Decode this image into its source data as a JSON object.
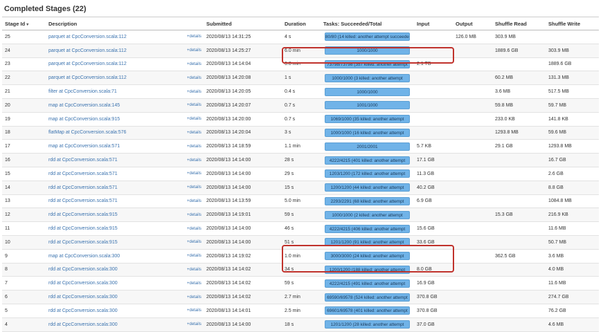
{
  "page": {
    "title": "Completed Stages (22)"
  },
  "columns": [
    {
      "label": "Stage Id",
      "sort": "▾"
    },
    {
      "label": "Description",
      "sort": ""
    },
    {
      "label": "",
      "sort": ""
    },
    {
      "label": "Submitted",
      "sort": ""
    },
    {
      "label": "Duration",
      "sort": ""
    },
    {
      "label": "Tasks: Succeeded/Total",
      "sort": ""
    },
    {
      "label": "Input",
      "sort": ""
    },
    {
      "label": "Output",
      "sort": ""
    },
    {
      "label": "Shuffle Read",
      "sort": ""
    },
    {
      "label": "Shuffle Write",
      "sort": ""
    }
  ],
  "details_label": "+details",
  "rows": [
    {
      "id": "25",
      "desc": "parquet at CpcConversion.scala:112",
      "submitted": "2020/08/13 14:31:25",
      "duration": "4 s",
      "tasks": "80/80 (14 killed: another attempt succeeded)",
      "input": "",
      "output": "126.0 MB",
      "shuffle_read": "303.9 MB",
      "shuffle_write": ""
    },
    {
      "id": "24",
      "desc": "parquet at CpcConversion.scala:112",
      "submitted": "2020/08/13 14:25:27",
      "duration": "6.0 min",
      "tasks": "1000/1000",
      "input": "",
      "output": "",
      "shuffle_read": "1889.6 GB",
      "shuffle_write": "303.9 MB"
    },
    {
      "id": "23",
      "desc": "parquet at CpcConversion.scala:112",
      "submitted": "2020/08/13 14:14:04",
      "duration": "6.8 min",
      "tasks": "73798/73798 (357 killed: another attempt",
      "input": "2.1 TB",
      "output": "",
      "shuffle_read": "",
      "shuffle_write": "1889.6 GB"
    },
    {
      "id": "22",
      "desc": "parquet at CpcConversion.scala:112",
      "submitted": "2020/08/13 14:20:08",
      "duration": "1 s",
      "tasks": "1000/1000 (3 killed: another attempt",
      "input": "",
      "output": "",
      "shuffle_read": "60.2 MB",
      "shuffle_write": "131.3 MB"
    },
    {
      "id": "21",
      "desc": "filter at CpcConversion.scala:71",
      "submitted": "2020/08/13 14:20:05",
      "duration": "0.4 s",
      "tasks": "1000/1000",
      "input": "",
      "output": "",
      "shuffle_read": "3.6 MB",
      "shuffle_write": "517.5 MB"
    },
    {
      "id": "20",
      "desc": "map at CpcConversion.scala:145",
      "submitted": "2020/08/13 14:20:07",
      "duration": "0.7 s",
      "tasks": "1001/1000",
      "input": "",
      "output": "",
      "shuffle_read": "59.8 MB",
      "shuffle_write": "59.7 MB"
    },
    {
      "id": "19",
      "desc": "map at CpcConversion.scala:915",
      "submitted": "2020/08/13 14:20:00",
      "duration": "0.7 s",
      "tasks": "1069/1000 (35 killed: another attempt",
      "input": "",
      "output": "",
      "shuffle_read": "233.0 KB",
      "shuffle_write": "141.8 KB"
    },
    {
      "id": "18",
      "desc": "flatMap at CpcConversion.scala:576",
      "submitted": "2020/08/13 14:20:04",
      "duration": "3 s",
      "tasks": "1000/1000 (16 killed: another attempt",
      "input": "",
      "output": "",
      "shuffle_read": "1293.8 MB",
      "shuffle_write": "59.6 MB"
    },
    {
      "id": "17",
      "desc": "map at CpcConversion.scala:571",
      "submitted": "2020/08/13 14:18:59",
      "duration": "1.1 min",
      "tasks": "2001/2001",
      "input": "5.7 KB",
      "output": "",
      "shuffle_read": "29.1 GB",
      "shuffle_write": "1293.8 MB"
    },
    {
      "id": "16",
      "desc": "rdd at CpcConversion.scala:571",
      "submitted": "2020/08/13 14:14:00",
      "duration": "28 s",
      "tasks": "4222/4215 (401 killed: another attempt",
      "input": "17.1 GB",
      "output": "",
      "shuffle_read": "",
      "shuffle_write": "16.7 GB"
    },
    {
      "id": "15",
      "desc": "rdd at CpcConversion.scala:571",
      "submitted": "2020/08/13 14:14:00",
      "duration": "29 s",
      "tasks": "1203/1200 (172 killed: another attempt",
      "input": "11.3 GB",
      "output": "",
      "shuffle_read": "",
      "shuffle_write": "2.6 GB"
    },
    {
      "id": "14",
      "desc": "rdd at CpcConversion.scala:571",
      "submitted": "2020/08/13 14:14:00",
      "duration": "15 s",
      "tasks": "1200/1200 (44 killed: another attempt",
      "input": "40.2 GB",
      "output": "",
      "shuffle_read": "",
      "shuffle_write": "8.8 GB"
    },
    {
      "id": "13",
      "desc": "rdd at CpcConversion.scala:571",
      "submitted": "2020/08/13 14:13:59",
      "duration": "5.0 min",
      "tasks": "2293/2291 (68 killed: another attempt",
      "input": "6.9 GB",
      "output": "",
      "shuffle_read": "",
      "shuffle_write": "1084.8 MB"
    },
    {
      "id": "12",
      "desc": "rdd at CpcConversion.scala:915",
      "submitted": "2020/08/13 14:19:01",
      "duration": "59 s",
      "tasks": "1000/1000 (2 killed: another attempt",
      "input": "",
      "output": "",
      "shuffle_read": "15.3 GB",
      "shuffle_write": "216.9 KB"
    },
    {
      "id": "11",
      "desc": "rdd at CpcConversion.scala:915",
      "submitted": "2020/08/13 14:14:00",
      "duration": "46 s",
      "tasks": "4222/4215 (406 killed: another attempt",
      "input": "15.6 GB",
      "output": "",
      "shuffle_read": "",
      "shuffle_write": "11.6 MB"
    },
    {
      "id": "10",
      "desc": "rdd at CpcConversion.scala:915",
      "submitted": "2020/08/13 14:14:00",
      "duration": "51 s",
      "tasks": "1201/1200 (91 killed: another attempt",
      "input": "33.6 GB",
      "output": "",
      "shuffle_read": "",
      "shuffle_write": "50.7 MB"
    },
    {
      "id": "9",
      "desc": "map at CpcConversion.scala:300",
      "submitted": "2020/08/13 14:19:02",
      "duration": "1.0 min",
      "tasks": "3000/3000 (24 killed: another attempt",
      "input": "",
      "output": "",
      "shuffle_read": "362.5 GB",
      "shuffle_write": "3.6 MB"
    },
    {
      "id": "8",
      "desc": "rdd at CpcConversion.scala:300",
      "submitted": "2020/08/13 14:14:02",
      "duration": "34 s",
      "tasks": "1200/1200 (188 killed: another attempt",
      "input": "8.0 GB",
      "output": "",
      "shuffle_read": "",
      "shuffle_write": "4.0 MB"
    },
    {
      "id": "7",
      "desc": "rdd at CpcConversion.scala:300",
      "submitted": "2020/08/13 14:14:02",
      "duration": "59 s",
      "tasks": "4222/4215 (491 killed: another attempt",
      "input": "16.9 GB",
      "output": "",
      "shuffle_read": "",
      "shuffle_write": "11.6 MB"
    },
    {
      "id": "6",
      "desc": "rdd at CpcConversion.scala:300",
      "submitted": "2020/08/13 14:14:02",
      "duration": "2.7 min",
      "tasks": "69590/69578 (524 killed: another attempt",
      "input": "370.8 GB",
      "output": "",
      "shuffle_read": "",
      "shuffle_write": "274.7 GB"
    },
    {
      "id": "5",
      "desc": "rdd at CpcConversion.scala:300",
      "submitted": "2020/08/13 14:14:01",
      "duration": "2.5 min",
      "tasks": "69601/69578 (401 killed: another attempt",
      "input": "370.8 GB",
      "output": "",
      "shuffle_read": "",
      "shuffle_write": "76.2 GB"
    },
    {
      "id": "4",
      "desc": "rdd at CpcConversion.scala:300",
      "submitted": "2020/08/13 14:14:00",
      "duration": "18 s",
      "tasks": "1201/1200 (28 killed: another attempt",
      "input": "37.0 GB",
      "output": "",
      "shuffle_read": "",
      "shuffle_write": "4.6 MB"
    }
  ],
  "highlight_color": "#c0312b"
}
